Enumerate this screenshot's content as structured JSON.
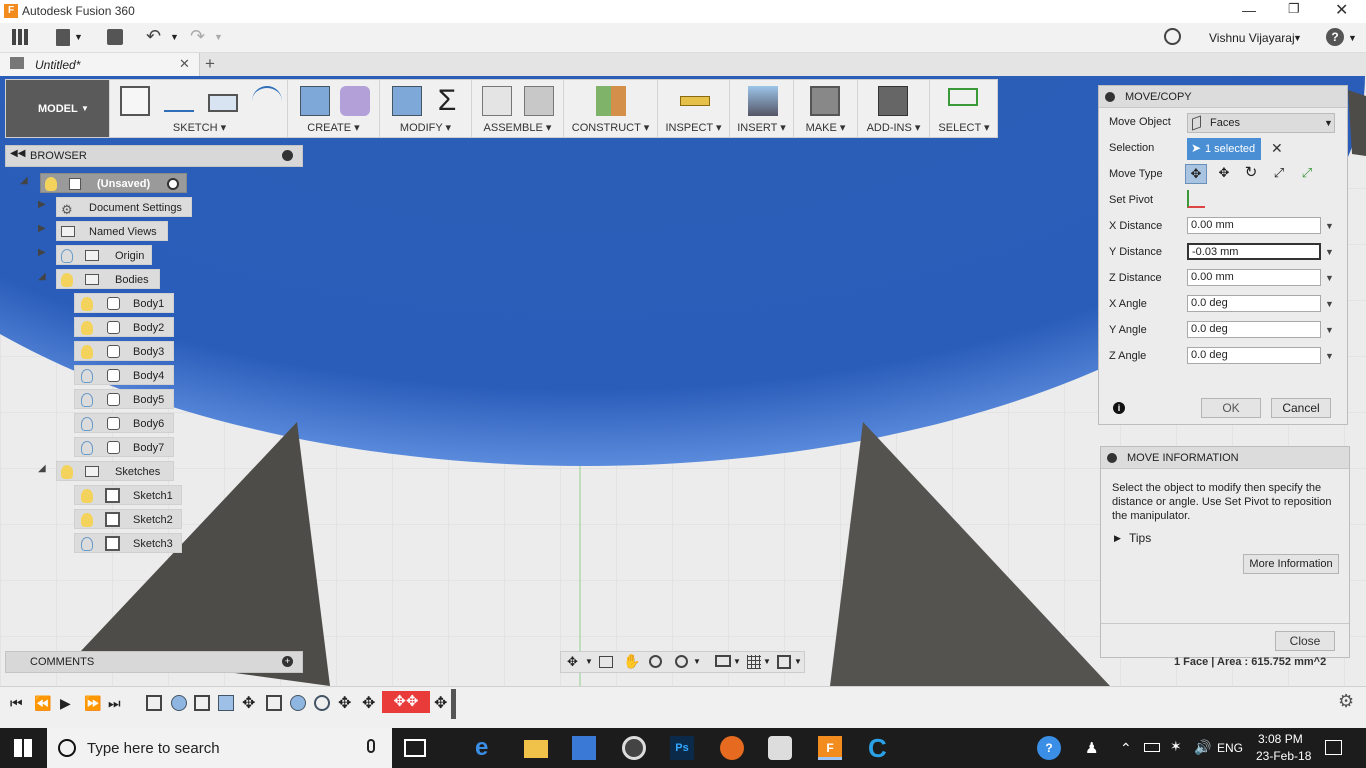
{
  "app": {
    "title": "Autodesk Fusion 360",
    "tab": "Untitled*",
    "user": "Vishnu Vijayaraj"
  },
  "ribbon": {
    "workspace": "MODEL",
    "groups": [
      "SKETCH",
      "CREATE",
      "MODIFY",
      "ASSEMBLE",
      "CONSTRUCT",
      "INSPECT",
      "INSERT",
      "MAKE",
      "ADD-INS",
      "SELECT"
    ]
  },
  "browser": {
    "title": "BROWSER",
    "root": "(Unsaved)",
    "document_settings": "Document Settings",
    "named_views": "Named Views",
    "origin": "Origin",
    "bodies_label": "Bodies",
    "bodies": [
      "Body1",
      "Body2",
      "Body3",
      "Body4",
      "Body5",
      "Body6",
      "Body7"
    ],
    "sketches_label": "Sketches",
    "sketches": [
      "Sketch1",
      "Sketch2",
      "Sketch3"
    ]
  },
  "comments": {
    "title": "COMMENTS"
  },
  "move_copy": {
    "title": "MOVE/COPY",
    "move_object_label": "Move Object",
    "move_object_value": "Faces",
    "selection_label": "Selection",
    "selection_value": "1 selected",
    "move_type_label": "Move Type",
    "set_pivot_label": "Set Pivot",
    "x_distance_label": "X Distance",
    "x_distance": "0.00 mm",
    "y_distance_label": "Y Distance",
    "y_distance": "-0.03 mm",
    "z_distance_label": "Z Distance",
    "z_distance": "0.00 mm",
    "x_angle_label": "X Angle",
    "x_angle": "0.0 deg",
    "y_angle_label": "Y Angle",
    "y_angle": "0.0 deg",
    "z_angle_label": "Z Angle",
    "z_angle": "0.0 deg",
    "ok": "OK",
    "cancel": "Cancel"
  },
  "move_info": {
    "title": "MOVE INFORMATION",
    "text": "Select the object to modify then specify the distance or angle. Use Set Pivot to reposition the manipulator.",
    "tips": "Tips",
    "more": "More Information",
    "close": "Close"
  },
  "status": "1 Face | Area : 615.752 mm^2",
  "taskbar": {
    "search_placeholder": "Type here to search",
    "time": "3:08 PM",
    "date": "23-Feb-18",
    "lang": "ENG"
  }
}
